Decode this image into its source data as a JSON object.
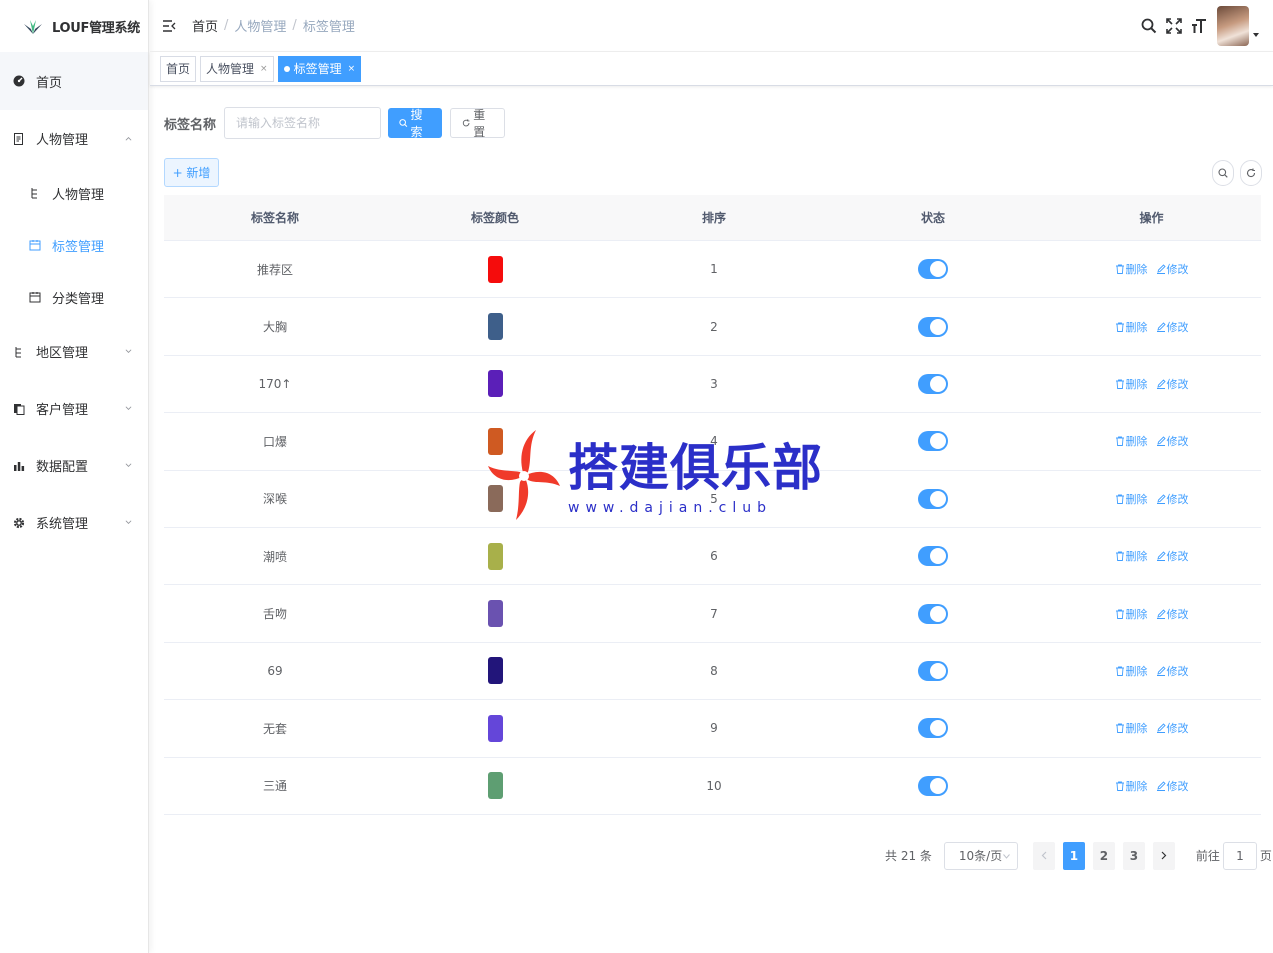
{
  "app": {
    "title": "LOUF管理系统"
  },
  "sidebar": {
    "home": "首页",
    "menus": [
      {
        "label": "人物管理",
        "icon": "document-icon",
        "expanded": true,
        "children": [
          {
            "label": "人物管理",
            "icon": "tree-icon",
            "active": false
          },
          {
            "label": "标签管理",
            "icon": "calendar-icon",
            "active": true
          },
          {
            "label": "分类管理",
            "icon": "calendar-icon",
            "active": false
          }
        ]
      },
      {
        "label": "地区管理",
        "icon": "tree-icon",
        "expanded": false
      },
      {
        "label": "客户管理",
        "icon": "copy-icon",
        "expanded": false
      },
      {
        "label": "数据配置",
        "icon": "bar-chart-icon",
        "expanded": false
      },
      {
        "label": "系统管理",
        "icon": "gear-icon",
        "expanded": false
      }
    ]
  },
  "header": {
    "breadcrumb": [
      "首页",
      "人物管理",
      "标签管理"
    ],
    "sep": "/"
  },
  "tags": [
    {
      "label": "首页",
      "closable": false,
      "active": false
    },
    {
      "label": "人物管理",
      "closable": true,
      "active": false
    },
    {
      "label": "标签管理",
      "closable": true,
      "active": true
    }
  ],
  "tag_close": "×",
  "search": {
    "label": "标签名称",
    "placeholder": "请输入标签名称",
    "search_btn": "搜索",
    "reset_btn": "重置"
  },
  "toolbar": {
    "add_btn": "+ 新增"
  },
  "table": {
    "columns": [
      "标签名称",
      "标签颜色",
      "排序",
      "状态",
      "操作"
    ],
    "delete_label": "删除",
    "edit_label": "修改",
    "rows": [
      {
        "name": "推荐区",
        "color": "#f50c0c",
        "sort": "1",
        "status": true
      },
      {
        "name": "大胸",
        "color": "#3e5f8a",
        "sort": "2",
        "status": true
      },
      {
        "name": "170↑",
        "color": "#5b1fb8",
        "sort": "3",
        "status": true
      },
      {
        "name": "口爆",
        "color": "#cf5a22",
        "sort": "4",
        "status": true
      },
      {
        "name": "深喉",
        "color": "#8a6a5a",
        "sort": "5",
        "status": true
      },
      {
        "name": "潮喷",
        "color": "#a8b04a",
        "sort": "6",
        "status": true
      },
      {
        "name": "舌吻",
        "color": "#6a52b0",
        "sort": "7",
        "status": true
      },
      {
        "name": "69",
        "color": "#22157a",
        "sort": "8",
        "status": true
      },
      {
        "name": "无套",
        "color": "#6446d9",
        "sort": "9",
        "status": true
      },
      {
        "name": "三通",
        "color": "#5e9e72",
        "sort": "10",
        "status": true
      }
    ]
  },
  "pagination": {
    "total": "共 21 条",
    "page_size": "10条/页",
    "pages": [
      "1",
      "2",
      "3"
    ],
    "current": "1",
    "goto_label": "前往",
    "goto_value": "1",
    "page_suffix": "页"
  },
  "watermark": {
    "title": "搭建俱乐部",
    "url": "www.dajian.club"
  }
}
